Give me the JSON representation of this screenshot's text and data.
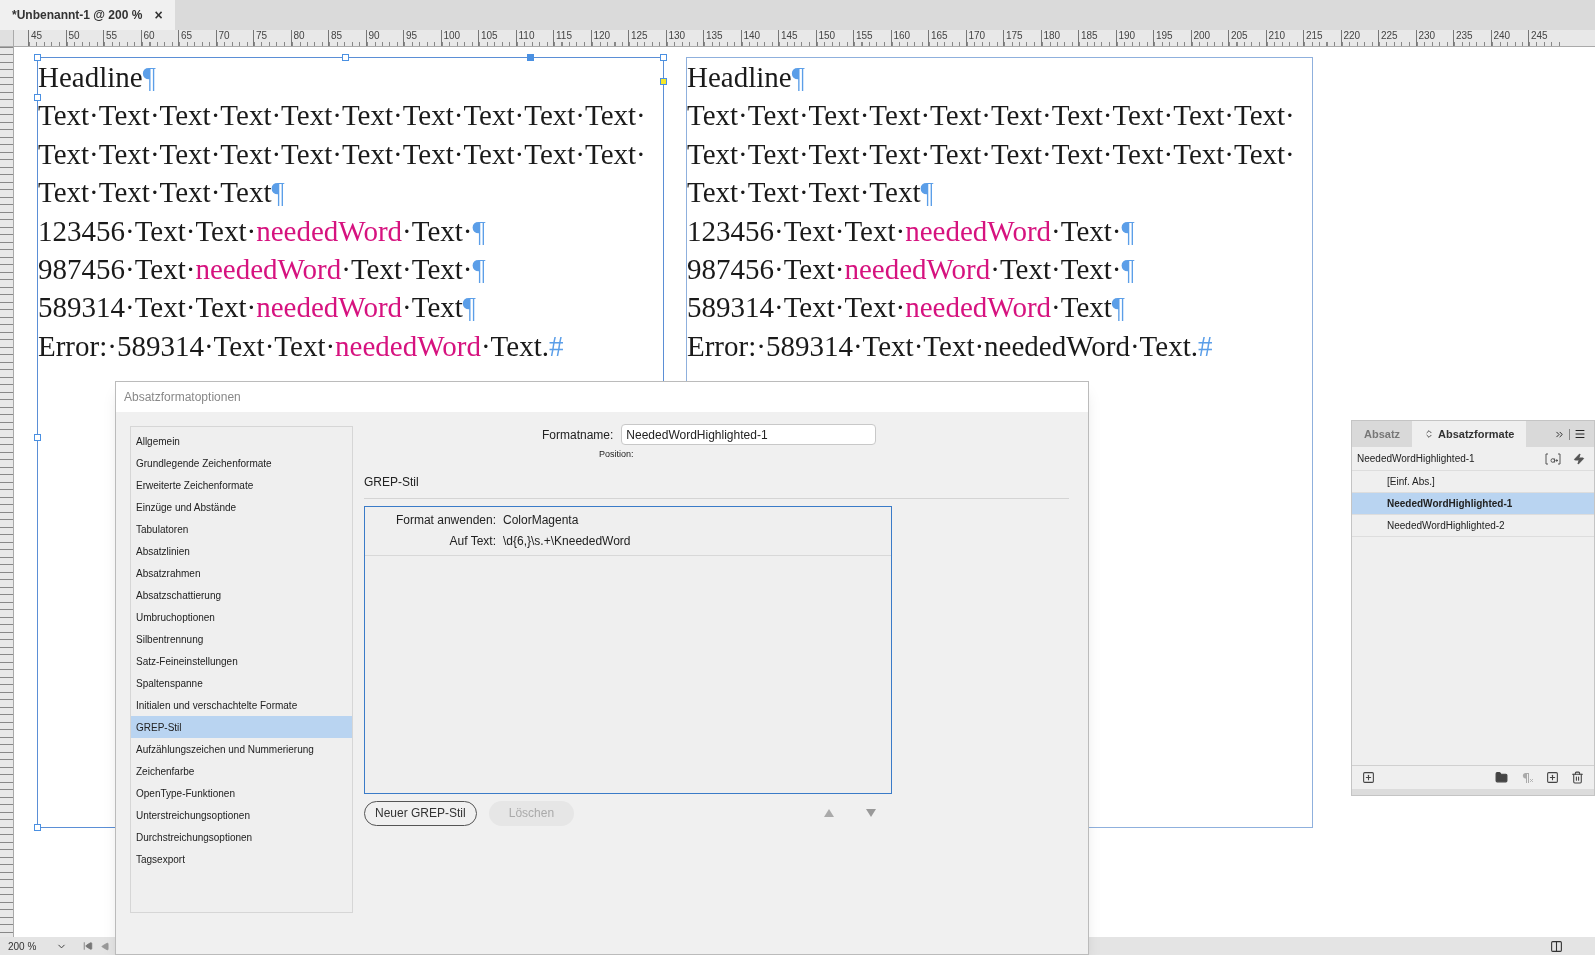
{
  "document_tab": {
    "title": "*Unbenannt-1 @ 200 %",
    "close": "×"
  },
  "ruler": {
    "labels": [
      "45",
      "50",
      "55",
      "60",
      "65",
      "70",
      "75",
      "80",
      "85",
      "90",
      "95",
      "100",
      "105",
      "110",
      "115",
      "120",
      "125",
      "130",
      "135",
      "140",
      "145",
      "150",
      "155",
      "160",
      "165",
      "170",
      "175",
      "180",
      "185",
      "190",
      "195",
      "200",
      "205",
      "210",
      "215",
      "220",
      "225",
      "230",
      "235",
      "240",
      "245"
    ]
  },
  "frames": [
    {
      "selected": true,
      "lines": [
        {
          "segments": [
            {
              "text": "Headline",
              "highlight": false
            }
          ],
          "mark": "¶"
        },
        {
          "segments": [
            {
              "text": "Text·Text·Text·Text·Text·Text·Text·Text·Text·Text·",
              "highlight": false
            }
          ]
        },
        {
          "segments": [
            {
              "text": "Text·Text·Text·Text·Text·Text·Text·Text·Text·Text·",
              "highlight": false
            }
          ]
        },
        {
          "segments": [
            {
              "text": "Text·Text·Text·Text",
              "highlight": false
            }
          ],
          "mark": "¶"
        },
        {
          "segments": [
            {
              "text": "123456·Text·Text·",
              "highlight": false
            },
            {
              "text": "neededWord",
              "highlight": true
            },
            {
              "text": "·Text·",
              "highlight": false
            }
          ],
          "mark": "¶"
        },
        {
          "segments": [
            {
              "text": "987456·Text·",
              "highlight": false
            },
            {
              "text": "neededWord",
              "highlight": true
            },
            {
              "text": "·Text·Text·",
              "highlight": false
            }
          ],
          "mark": "¶"
        },
        {
          "segments": [
            {
              "text": "589314·Text·Text·",
              "highlight": false
            },
            {
              "text": "neededWord",
              "highlight": true
            },
            {
              "text": "·Text",
              "highlight": false
            }
          ],
          "mark": "¶"
        },
        {
          "segments": [
            {
              "text": "Error:·589314·Text·Text·",
              "highlight": false
            },
            {
              "text": "neededWord",
              "highlight": true
            },
            {
              "text": "·Text.",
              "highlight": false
            }
          ],
          "mark": "#"
        }
      ]
    },
    {
      "selected": false,
      "lines": [
        {
          "segments": [
            {
              "text": "Headline",
              "highlight": false
            }
          ],
          "mark": "¶"
        },
        {
          "segments": [
            {
              "text": "Text·Text·Text·Text·Text·Text·Text·Text·Text·Text·",
              "highlight": false
            }
          ]
        },
        {
          "segments": [
            {
              "text": "Text·Text·Text·Text·Text·Text·Text·Text·Text·Text·",
              "highlight": false
            }
          ]
        },
        {
          "segments": [
            {
              "text": "Text·Text·Text·Text",
              "highlight": false
            }
          ],
          "mark": "¶"
        },
        {
          "segments": [
            {
              "text": "123456·Text·Text·",
              "highlight": false
            },
            {
              "text": "neededWord",
              "highlight": true
            },
            {
              "text": "·Text·",
              "highlight": false
            }
          ],
          "mark": "¶"
        },
        {
          "segments": [
            {
              "text": "987456·Text·",
              "highlight": false
            },
            {
              "text": "neededWord",
              "highlight": true
            },
            {
              "text": "·Text·Text·",
              "highlight": false
            }
          ],
          "mark": "¶"
        },
        {
          "segments": [
            {
              "text": "589314·Text·Text·",
              "highlight": false
            },
            {
              "text": "neededWord",
              "highlight": true
            },
            {
              "text": "·Text",
              "highlight": false
            }
          ],
          "mark": "¶"
        },
        {
          "segments": [
            {
              "text": "Error:·589314·Text·Text·neededWord·Text.",
              "highlight": false
            }
          ],
          "mark": "#"
        }
      ]
    }
  ],
  "dialog": {
    "title": "Absatzformatoptionen",
    "categories": [
      {
        "label": "Allgemein",
        "selected": false
      },
      {
        "label": "Grundlegende Zeichenformate",
        "selected": false
      },
      {
        "label": "Erweiterte Zeichenformate",
        "selected": false
      },
      {
        "label": "Einzüge und Abstände",
        "selected": false
      },
      {
        "label": "Tabulatoren",
        "selected": false
      },
      {
        "label": "Absatzlinien",
        "selected": false
      },
      {
        "label": "Absatzrahmen",
        "selected": false
      },
      {
        "label": "Absatzschattierung",
        "selected": false
      },
      {
        "label": "Umbruchoptionen",
        "selected": false
      },
      {
        "label": "Silbentrennung",
        "selected": false
      },
      {
        "label": "Satz-Feineinstellungen",
        "selected": false
      },
      {
        "label": "Spaltenspanne",
        "selected": false
      },
      {
        "label": "Initialen und verschachtelte Formate",
        "selected": false
      },
      {
        "label": "GREP-Stil",
        "selected": true
      },
      {
        "label": "Aufzählungszeichen und Nummerierung",
        "selected": false
      },
      {
        "label": "Zeichenfarbe",
        "selected": false
      },
      {
        "label": "OpenType-Funktionen",
        "selected": false
      },
      {
        "label": "Unterstreichungsoptionen",
        "selected": false
      },
      {
        "label": "Durchstreichungsoptionen",
        "selected": false
      },
      {
        "label": "Tagsexport",
        "selected": false
      }
    ],
    "format_name_label": "Formatname:",
    "format_name": "NeededWordHighlighted-1",
    "position_label": "Position:",
    "section_title": "GREP-Stil",
    "grep_rules": [
      {
        "apply_label": "Format anwenden:",
        "apply_value": "ColorMagenta",
        "text_label": "Auf Text:",
        "text_value": "\\d{6,}\\s.+\\KneededWord"
      }
    ],
    "buttons": [
      {
        "label": "Neuer GREP-Stil",
        "disabled": false
      },
      {
        "label": "Löschen",
        "disabled": true
      }
    ]
  },
  "panel": {
    "tabs": [
      {
        "label": "Absatz",
        "selected": false
      },
      {
        "label": "Absatzformate",
        "selected": true
      }
    ],
    "current_style": "NeededWordHighlighted-1",
    "styles": [
      {
        "label": "[Einf. Abs.]",
        "selected": false
      },
      {
        "label": "NeededWordHighlighted-1",
        "selected": true
      },
      {
        "label": "NeededWordHighlighted-2",
        "selected": false
      }
    ]
  },
  "status_bar": {
    "zoom": "200 %"
  }
}
